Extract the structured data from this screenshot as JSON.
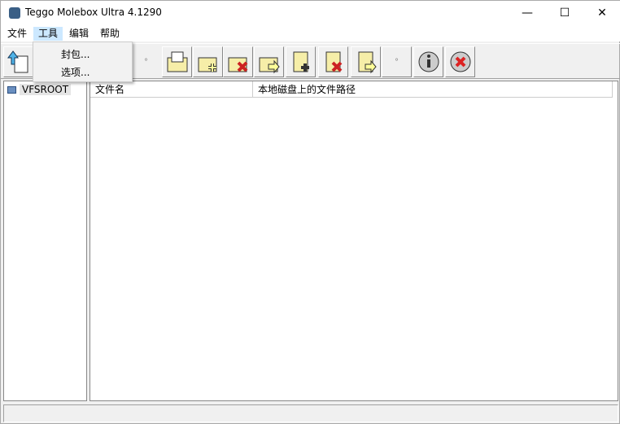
{
  "window": {
    "title": "Teggo Molebox Ultra 4.1290",
    "minimize": "—",
    "maximize": "☐",
    "close": "✕"
  },
  "menu": [
    "文件",
    "工具",
    "编辑",
    "帮助"
  ],
  "popup": [
    "封包...",
    "选项..."
  ],
  "toolbar": {
    "separator": "°",
    "buttons": [
      "new-project",
      "open-folder",
      "add-folder",
      "remove-folder",
      "export-folder",
      "add-file",
      "remove-file",
      "export-file",
      "info",
      "exit"
    ]
  },
  "tree": {
    "root": "VFSROOT"
  },
  "list": {
    "columns": [
      "文件名",
      "本地磁盘上的文件路径"
    ]
  }
}
